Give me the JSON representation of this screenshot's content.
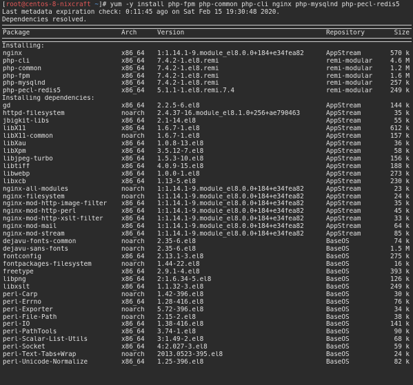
{
  "prompt": {
    "user_host": "root@centos-8-nixcraft",
    "path": "~",
    "symbol": "#",
    "command": "yum -y install php-fpm php-common php-cli nginx php-mysqlnd php-pecl-redis5"
  },
  "messages": [
    "Last metadata expiration check: 0:11:45 ago on Sat Feb 15 19:30:48 2020.",
    "Dependencies resolved."
  ],
  "table": {
    "headers": {
      "package": "Package",
      "arch": "Arch",
      "version": "Version",
      "repository": "Repository",
      "size": "Size"
    },
    "sections": [
      {
        "title": "Installing:",
        "rows": [
          [
            "nginx",
            "x86_64",
            "1:1.14.1-9.module_el8.0.0+184+e34fea82",
            "AppStream",
            "570 k"
          ],
          [
            "php-cli",
            "x86_64",
            "7.4.2-1.el8.remi",
            "remi-modular",
            "4.6 M"
          ],
          [
            "php-common",
            "x86_64",
            "7.4.2-1.el8.remi",
            "remi-modular",
            "1.2 M"
          ],
          [
            "php-fpm",
            "x86_64",
            "7.4.2-1.el8.remi",
            "remi-modular",
            "1.6 M"
          ],
          [
            "php-mysqlnd",
            "x86_64",
            "7.4.2-1.el8.remi",
            "remi-modular",
            "257 k"
          ],
          [
            "php-pecl-redis5",
            "x86_64",
            "5.1.1-1.el8.remi.7.4",
            "remi-modular",
            "249 k"
          ]
        ]
      },
      {
        "title": "Installing dependencies:",
        "rows": [
          [
            "gd",
            "x86_64",
            "2.2.5-6.el8",
            "AppStream",
            "144 k"
          ],
          [
            "httpd-filesystem",
            "noarch",
            "2.4.37-16.module_el8.1.0+256+ae790463",
            "AppStream",
            "35 k"
          ],
          [
            "jbigkit-libs",
            "x86_64",
            "2.1-14.el8",
            "AppStream",
            "55 k"
          ],
          [
            "libX11",
            "x86_64",
            "1.6.7-1.el8",
            "AppStream",
            "612 k"
          ],
          [
            "libX11-common",
            "noarch",
            "1.6.7-1.el8",
            "AppStream",
            "157 k"
          ],
          [
            "libXau",
            "x86_64",
            "1.0.8-13.el8",
            "AppStream",
            "36 k"
          ],
          [
            "libXpm",
            "x86_64",
            "3.5.12-7.el8",
            "AppStream",
            "58 k"
          ],
          [
            "libjpeg-turbo",
            "x86_64",
            "1.5.3-10.el8",
            "AppStream",
            "156 k"
          ],
          [
            "libtiff",
            "x86_64",
            "4.0.9-15.el8",
            "AppStream",
            "188 k"
          ],
          [
            "libwebp",
            "x86_64",
            "1.0.0-1.el8",
            "AppStream",
            "273 k"
          ],
          [
            "libxcb",
            "x86_64",
            "1.13-5.el8",
            "AppStream",
            "230 k"
          ],
          [
            "nginx-all-modules",
            "noarch",
            "1:1.14.1-9.module_el8.0.0+184+e34fea82",
            "AppStream",
            "23 k"
          ],
          [
            "nginx-filesystem",
            "noarch",
            "1:1.14.1-9.module_el8.0.0+184+e34fea82",
            "AppStream",
            "24 k"
          ],
          [
            "nginx-mod-http-image-filter",
            "x86_64",
            "1:1.14.1-9.module_el8.0.0+184+e34fea82",
            "AppStream",
            "35 k"
          ],
          [
            "nginx-mod-http-perl",
            "x86_64",
            "1:1.14.1-9.module_el8.0.0+184+e34fea82",
            "AppStream",
            "45 k"
          ],
          [
            "nginx-mod-http-xslt-filter",
            "x86_64",
            "1:1.14.1-9.module_el8.0.0+184+e34fea82",
            "AppStream",
            "33 k"
          ],
          [
            "nginx-mod-mail",
            "x86_64",
            "1:1.14.1-9.module_el8.0.0+184+e34fea82",
            "AppStream",
            "64 k"
          ],
          [
            "nginx-mod-stream",
            "x86_64",
            "1:1.14.1-9.module_el8.0.0+184+e34fea82",
            "AppStream",
            "85 k"
          ],
          [
            "dejavu-fonts-common",
            "noarch",
            "2.35-6.el8",
            "BaseOS",
            "74 k"
          ],
          [
            "dejavu-sans-fonts",
            "noarch",
            "2.35-6.el8",
            "BaseOS",
            "1.5 M"
          ],
          [
            "fontconfig",
            "x86_64",
            "2.13.1-3.el8",
            "BaseOS",
            "275 k"
          ],
          [
            "fontpackages-filesystem",
            "noarch",
            "1.44-22.el8",
            "BaseOS",
            "16 k"
          ],
          [
            "freetype",
            "x86_64",
            "2.9.1-4.el8",
            "BaseOS",
            "393 k"
          ],
          [
            "libpng",
            "x86_64",
            "2:1.6.34-5.el8",
            "BaseOS",
            "126 k"
          ],
          [
            "libxslt",
            "x86_64",
            "1.1.32-3.el8",
            "BaseOS",
            "249 k"
          ],
          [
            "perl-Carp",
            "noarch",
            "1.42-396.el8",
            "BaseOS",
            "30 k"
          ],
          [
            "perl-Errno",
            "x86_64",
            "1.28-416.el8",
            "BaseOS",
            "76 k"
          ],
          [
            "perl-Exporter",
            "noarch",
            "5.72-396.el8",
            "BaseOS",
            "34 k"
          ],
          [
            "perl-File-Path",
            "noarch",
            "2.15-2.el8",
            "BaseOS",
            "38 k"
          ],
          [
            "perl-IO",
            "x86_64",
            "1.38-416.el8",
            "BaseOS",
            "141 k"
          ],
          [
            "perl-PathTools",
            "x86_64",
            "3.74-1.el8",
            "BaseOS",
            "90 k"
          ],
          [
            "perl-Scalar-List-Utils",
            "x86_64",
            "3:1.49-2.el8",
            "BaseOS",
            "68 k"
          ],
          [
            "perl-Socket",
            "x86_64",
            "4:2.027-3.el8",
            "BaseOS",
            "59 k"
          ],
          [
            "perl-Text-Tabs+Wrap",
            "noarch",
            "2013.0523-395.el8",
            "BaseOS",
            "24 k"
          ],
          [
            "perl-Unicode-Normalize",
            "x86_64",
            "1.25-396.el8",
            "BaseOS",
            "82 k"
          ]
        ]
      }
    ]
  }
}
